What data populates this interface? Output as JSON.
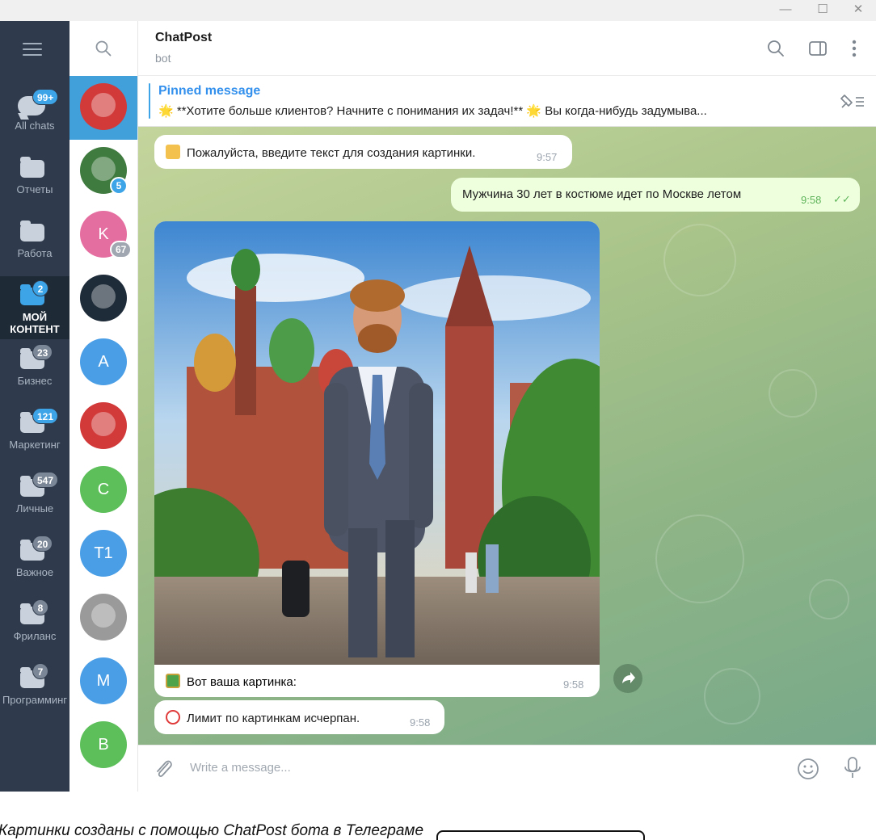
{
  "window": {
    "minimize": "—",
    "maximize": "☐",
    "close": "✕"
  },
  "folders": [
    {
      "label": "All chats",
      "badge": "99+",
      "icon": "chats-icon",
      "active": false,
      "muted": false
    },
    {
      "label": "Отчеты",
      "badge": "",
      "icon": "folder-icon",
      "active": false,
      "muted": false
    },
    {
      "label": "Работа",
      "badge": "",
      "icon": "folder-icon",
      "active": false,
      "muted": false
    },
    {
      "label": "МОЙ КОНТЕНТ",
      "badge": "2",
      "icon": "folder-icon",
      "active": true,
      "muted": false
    },
    {
      "label": "Бизнес",
      "badge": "23",
      "icon": "folder-icon",
      "active": false,
      "muted": true
    },
    {
      "label": "Маркетинг",
      "badge": "121",
      "icon": "folder-icon",
      "active": false,
      "muted": false
    },
    {
      "label": "Личные",
      "badge": "547",
      "icon": "folder-icon",
      "active": false,
      "muted": true
    },
    {
      "label": "Важное",
      "badge": "20",
      "icon": "folder-icon",
      "active": false,
      "muted": true
    },
    {
      "label": "Фриланс",
      "badge": "8",
      "icon": "folder-icon",
      "active": false,
      "muted": true
    },
    {
      "label": "Программинг",
      "badge": "7",
      "icon": "folder-icon",
      "active": false,
      "muted": true
    }
  ],
  "chat_list": [
    {
      "initials": "",
      "badge": "",
      "color": "#d23a3a",
      "kind": "red-cat-avatar",
      "active": true
    },
    {
      "initials": "",
      "badge": "5",
      "color": "#3f7a3f",
      "kind": "man-photo-avatar",
      "active": false
    },
    {
      "initials": "K",
      "badge": "67",
      "color": "#e56ea0",
      "kind": "letter",
      "active": false,
      "badge_grey": true
    },
    {
      "initials": "",
      "badge": "",
      "color": "#1e2b38",
      "kind": "robot-avatar",
      "active": false
    },
    {
      "initials": "A",
      "badge": "",
      "color": "#4a9ee6",
      "kind": "letter",
      "active": false
    },
    {
      "initials": "",
      "badge": "",
      "color": "#d23a3a",
      "kind": "red-cat-avatar",
      "active": false
    },
    {
      "initials": "C",
      "badge": "",
      "color": "#5cbf5a",
      "kind": "letter",
      "active": false
    },
    {
      "initials": "T1",
      "badge": "",
      "color": "#4a9ee6",
      "kind": "letter",
      "active": false
    },
    {
      "initials": "",
      "badge": "",
      "color": "#9a9a9a",
      "kind": "grey-cat-avatar",
      "active": false
    },
    {
      "initials": "M",
      "badge": "",
      "color": "#4a9ee6",
      "kind": "letter",
      "active": false
    },
    {
      "initials": "B",
      "badge": "",
      "color": "#5cbf5a",
      "kind": "letter",
      "active": false
    }
  ],
  "header": {
    "title": "ChatPost",
    "status": "bot"
  },
  "pinned": {
    "title": "Pinned message",
    "text": "🌟 **Хотите больше клиентов? Начните с понимания их задач!** 🌟  Вы когда-нибудь задумыва..."
  },
  "messages": {
    "prompt_request": {
      "text": "Пожалуйста, введите текст для создания картинки.",
      "time": "9:57",
      "emoji": "memo-emoji"
    },
    "user_prompt": {
      "text": "Мужчина 30 лет в костюме идет по Москве летом",
      "time": "9:58",
      "status": "✓✓"
    },
    "photo_caption": {
      "text": "Вот ваша картинка:",
      "time": "9:58",
      "emoji": "framed-picture-emoji"
    },
    "limit": {
      "text": "Лимит по картинкам исчерпан.",
      "time": "9:58",
      "emoji": "no-entry-emoji"
    }
  },
  "composer": {
    "placeholder": "Write a message..."
  },
  "caption": "Картинки созданы с помощью ChatPost бота в Телеграме",
  "colors": {
    "accent": "#3da4e8",
    "rail": "#2f3b4c",
    "out_bubble": "#eeffde",
    "link": "#3390ec"
  }
}
